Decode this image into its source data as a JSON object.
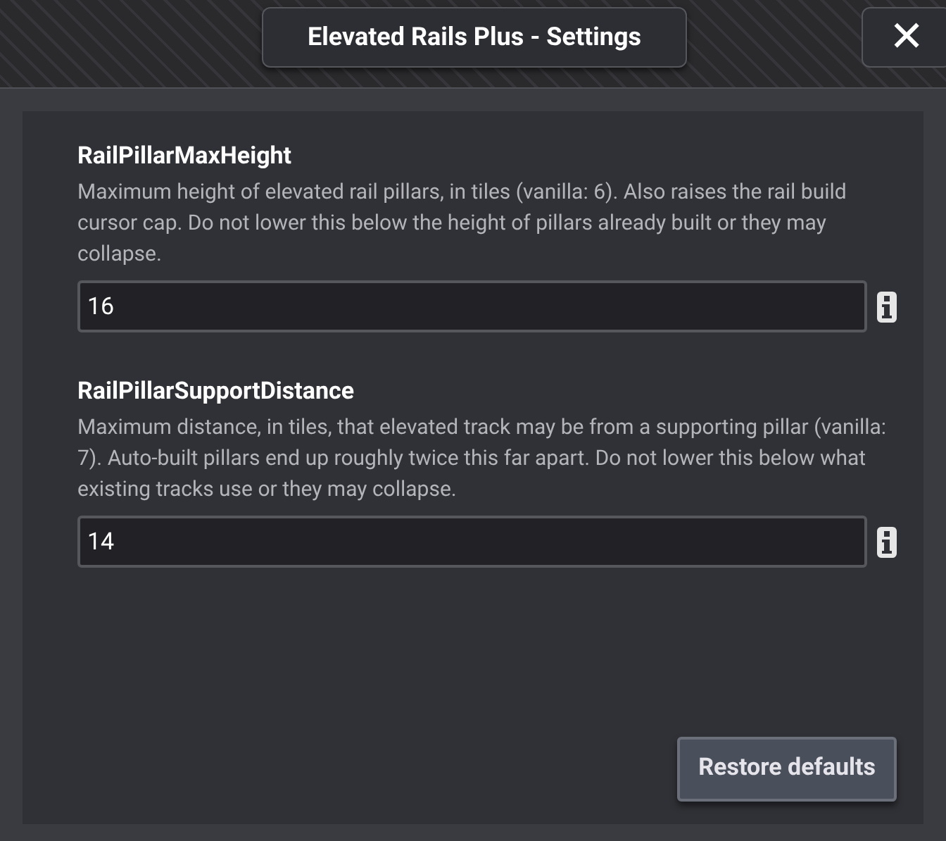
{
  "window": {
    "title": "Elevated Rails Plus - Settings",
    "close": "✕"
  },
  "settings": [
    {
      "name": "RailPillarMaxHeight",
      "description": "Maximum height of elevated rail pillars, in tiles (vanilla: 6). Also raises the rail build cursor cap. Do not lower this below the height of pillars already built or they may collapse.",
      "value": "16"
    },
    {
      "name": "RailPillarSupportDistance",
      "description": "Maximum distance, in tiles, that elevated track may be from a supporting pillar (vanilla: 7). Auto-built pillars end up roughly twice this far apart. Do not lower this below what existing tracks use or they may collapse.",
      "value": "14"
    }
  ],
  "buttons": [
    "Restore defaults"
  ]
}
